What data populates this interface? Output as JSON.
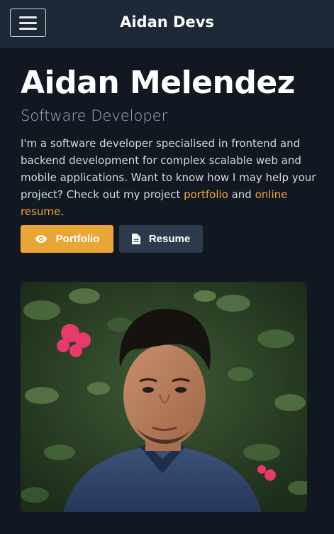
{
  "navbar": {
    "brand": "Aidan Devs",
    "menu_icon": "hamburger-icon"
  },
  "hero": {
    "name": "Aidan Melendez",
    "role": "Software Developer",
    "bio_prefix": "I'm a software developer specialised in frontend and backend development for complex scalable web and mobile applications. Want to know how I may help your project? Check out my project ",
    "portfolio_link": "portfolio",
    "bio_and": " and ",
    "resume_link": "online resume",
    "bio_suffix": "."
  },
  "buttons": {
    "portfolio_label": "Portfolio",
    "portfolio_icon": "eye-icon",
    "resume_label": "Resume",
    "resume_icon": "document-icon"
  },
  "colors": {
    "background": "#121821",
    "navbar": "#1e2937",
    "accent": "#eaa635",
    "secondary_button": "#2d3a4d"
  }
}
